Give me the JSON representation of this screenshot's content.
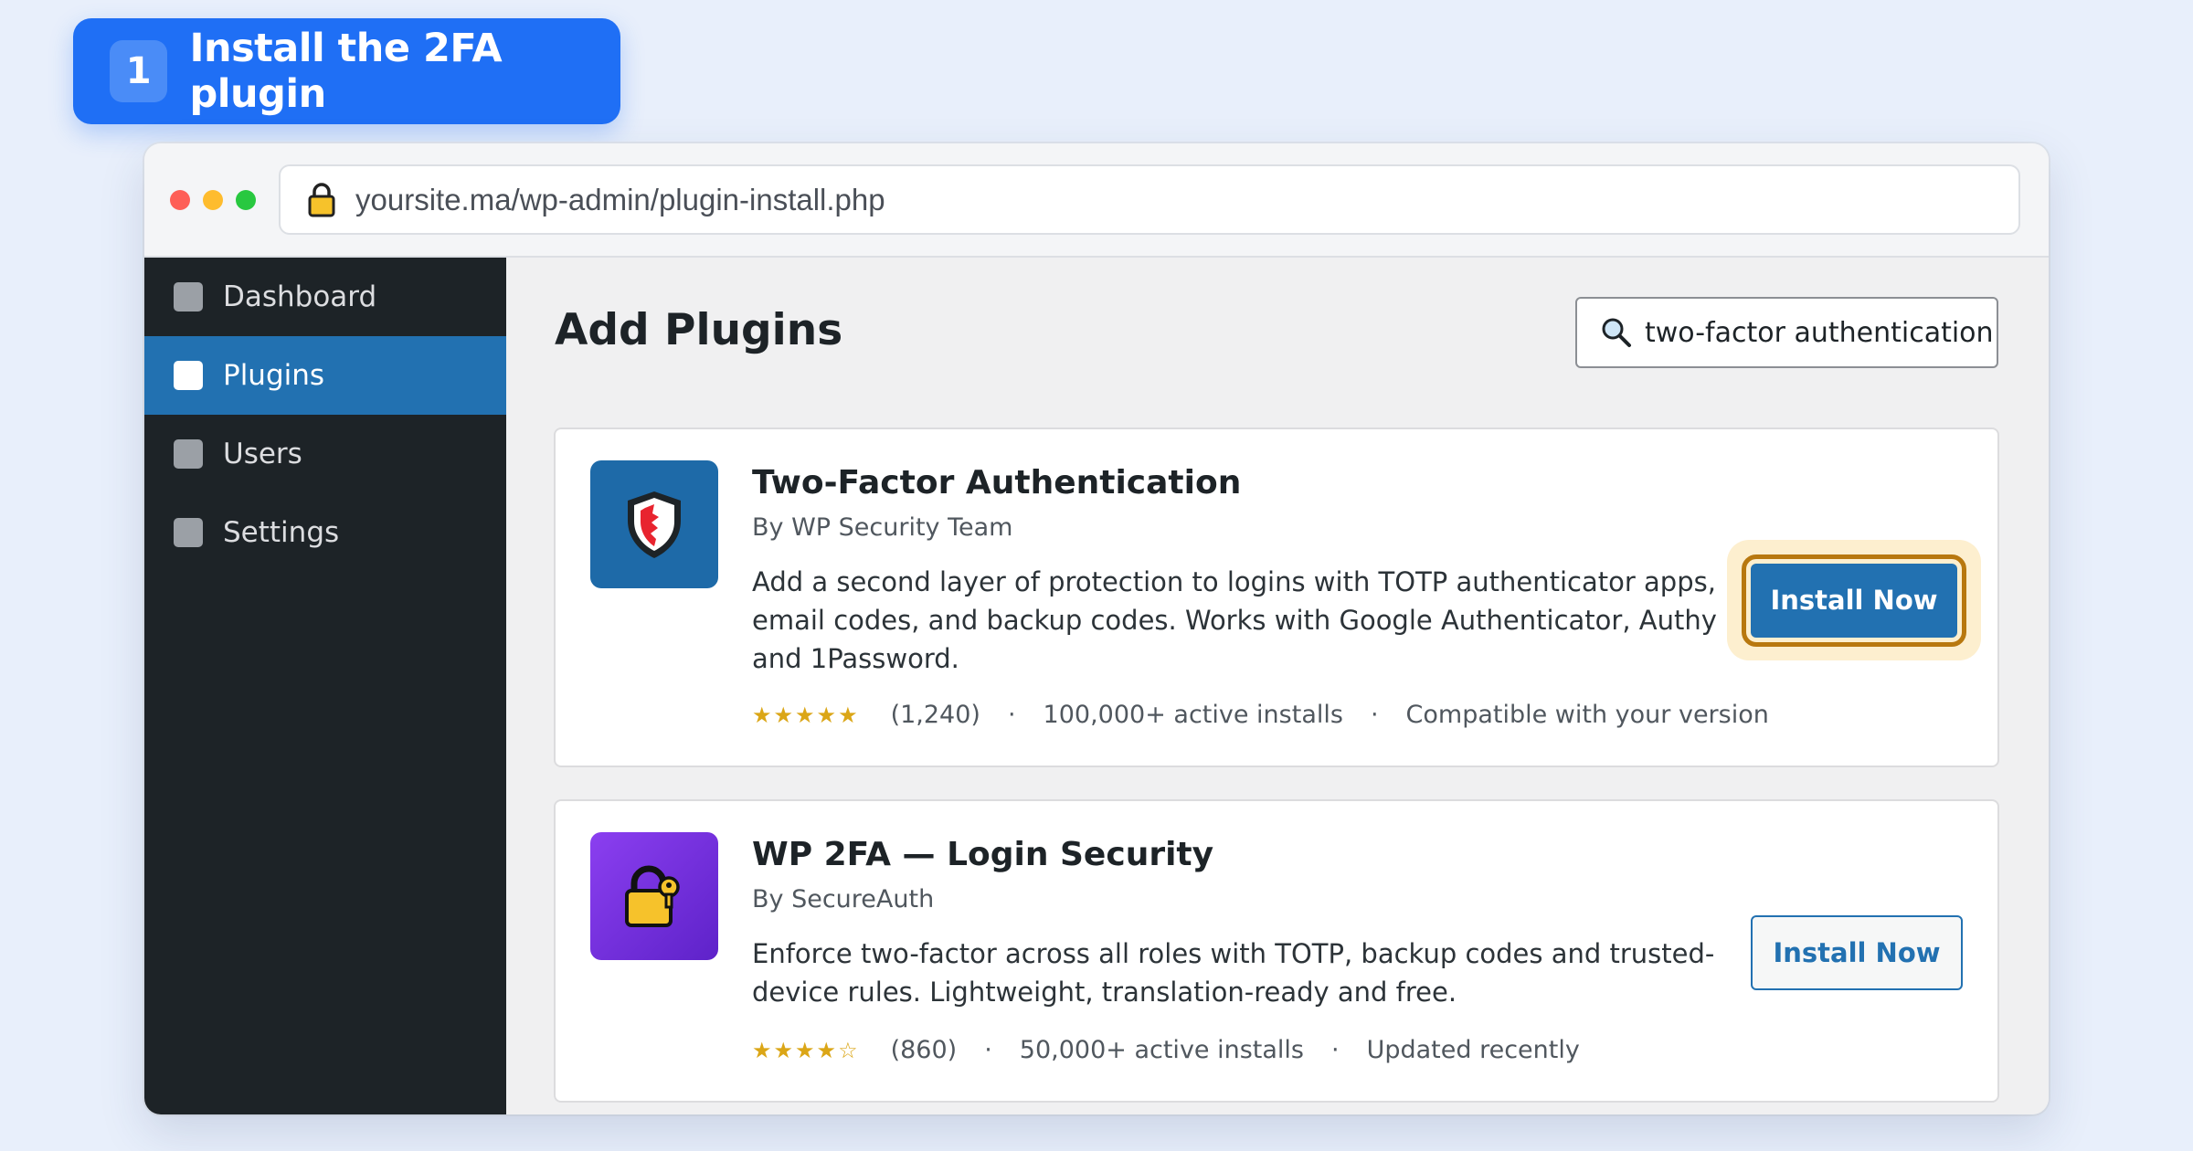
{
  "step": {
    "number": "1",
    "title": "Install the 2FA plugin"
  },
  "browser": {
    "url": "yoursite.ma/wp-admin/plugin-install.php"
  },
  "sidebar": {
    "items": [
      {
        "label": "Dashboard",
        "active": false
      },
      {
        "label": "Plugins",
        "active": true
      },
      {
        "label": "Users",
        "active": false
      },
      {
        "label": "Settings",
        "active": false
      }
    ]
  },
  "main": {
    "title": "Add Plugins",
    "search": {
      "value": "two-factor authentication",
      "icon": "search-icon"
    }
  },
  "plugins": [
    {
      "name": "Two-Factor Authentication",
      "author": "By WP Security Team",
      "description": "Add a second layer of protection to logins with TOTP authenticator apps, email codes, and backup codes. Works with Google Authenticator, Authy and 1Password.",
      "stars": "★★★★★",
      "rating_count": "(1,240)",
      "installs": "100,000+ active installs",
      "note": "Compatible with your version",
      "button": "Install Now",
      "icon": "shield-icon",
      "highlighted": true
    },
    {
      "name": "WP 2FA — Login Security",
      "author": "By SecureAuth",
      "description": "Enforce two-factor across all roles with TOTP, backup codes and trusted-device rules. Lightweight, translation-ready and free.",
      "stars": "★★★★☆",
      "rating_count": "(860)",
      "installs": "50,000+ active installs",
      "note": "Updated recently",
      "button": "Install Now",
      "icon": "padlock-key-icon",
      "highlighted": false
    }
  ],
  "colors": {
    "accent": "#1f6ff5",
    "wp_blue": "#2271b1",
    "sidebar_bg": "#1d2327",
    "highlight_ring": "#b8780f",
    "star": "#dba617"
  }
}
